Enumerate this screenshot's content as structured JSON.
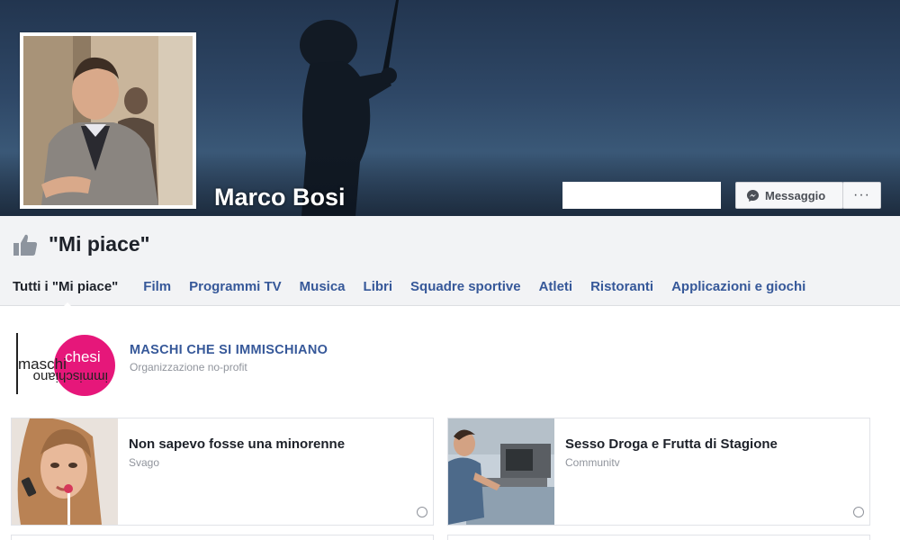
{
  "profile": {
    "name": "Marco Bosi",
    "message_button": "Messaggio",
    "more_button": "···"
  },
  "likes": {
    "title": "\"Mi piace\"",
    "tabs": [
      {
        "label": "Tutti i \"Mi piace\"",
        "active": true
      },
      {
        "label": "Film"
      },
      {
        "label": "Programmi TV"
      },
      {
        "label": "Musica"
      },
      {
        "label": "Libri"
      },
      {
        "label": "Squadre sportive"
      },
      {
        "label": "Atleti"
      },
      {
        "label": "Ristoranti"
      },
      {
        "label": "Applicazioni e giochi"
      }
    ]
  },
  "pages": [
    {
      "title": "MASCHI CHE SI IMMISCHIANO",
      "category": "Organizzazione no-profit",
      "logo_text_top": "maschi",
      "logo_text_pink": "chesi",
      "logo_text_mirror": "immischiano"
    },
    {
      "title": "Non sapevo fosse una minorenne",
      "category": "Svago"
    },
    {
      "title": "Sesso Droga e Frutta di Stagione",
      "category": "Communitv"
    }
  ],
  "colors": {
    "link_blue": "#365899",
    "logo_pink": "#e6177a",
    "button_bg": "#f6f7f9"
  }
}
